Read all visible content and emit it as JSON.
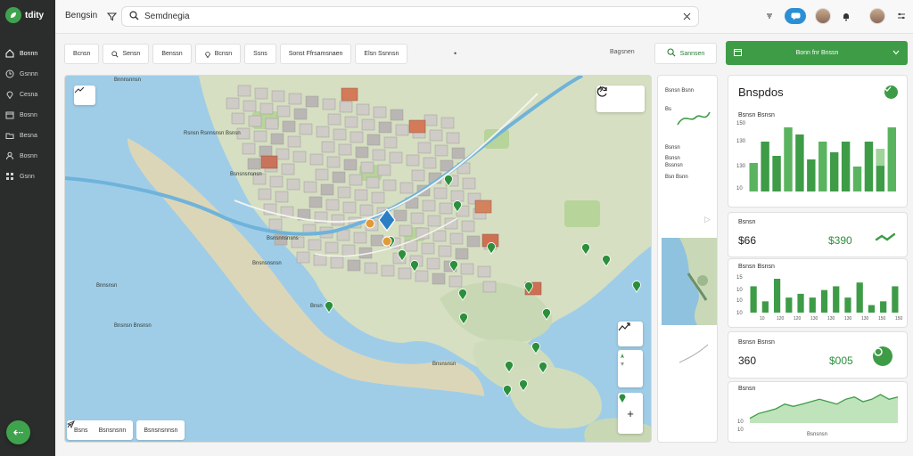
{
  "app": {
    "logo_text": "tdity",
    "brand": "Bengsin"
  },
  "rail": [
    {
      "label": "Bonnn",
      "icon": "home-icon"
    },
    {
      "label": "Gsnnn",
      "icon": "clock-icon"
    },
    {
      "label": "Cesna",
      "icon": "pin-icon"
    },
    {
      "label": "Bosnn",
      "icon": "calendar-icon"
    },
    {
      "label": "Besna",
      "icon": "folder-icon"
    },
    {
      "label": "Bosnn",
      "icon": "person-icon"
    },
    {
      "label": "Gsnn",
      "icon": "grid-icon"
    }
  ],
  "search": {
    "value": "Semdnegia"
  },
  "filters": [
    {
      "label": "Bcnsn",
      "icon": null
    },
    {
      "label": "Sensn",
      "icon": "search-icon"
    },
    {
      "label": "Benssn",
      "icon": null
    },
    {
      "label": "Bcnsn",
      "icon": "pin-icon"
    },
    {
      "label": "Ssns",
      "icon": null
    },
    {
      "label": "Sonst Ffrsamsnaen",
      "icon": null
    },
    {
      "label": "Elsn Ssnnsn",
      "icon": null
    }
  ],
  "filters_more": "•",
  "reset_label": "Bagsnen",
  "saved_label": "Sannsen",
  "primary_label": "Bonn fnr Bnssn",
  "map": {
    "labels": [
      {
        "text": "Bnnnsnnsn"
      },
      {
        "text": "Rsnsn Rsnnsnsn Bsnsn"
      },
      {
        "text": "Bsnsnsnsnsn"
      },
      {
        "text": "Bsnsnnsnsns"
      },
      {
        "text": "Bnsnsnsnsn"
      },
      {
        "text": "Bnsn"
      },
      {
        "text": "Bnsnsn Bnsnsn"
      },
      {
        "text": "Bnsnsnsn"
      },
      {
        "text": "Bnnsnsn"
      }
    ],
    "bottom_left": "Bsns",
    "bottom_mid": "Bsnsnsnn",
    "bottom_right": "Bsnsnsnnsn"
  },
  "mid_panel": {
    "rows": [
      "Bsnsn Bsnn",
      "Bs",
      "Bsnsn",
      "Bsnsn",
      "Bssnsn",
      "Bsn Bsnn"
    ]
  },
  "cards": {
    "overview": {
      "title": "Bnspdos",
      "caption": "Bsnsn Bsnsn",
      "ticks": [
        "150",
        "130",
        "130",
        "10"
      ],
      "values": [
        8,
        14,
        10,
        18,
        16,
        9,
        14,
        11,
        14,
        7,
        14,
        12,
        18
      ],
      "tick_levels": [
        150,
        130,
        130,
        10
      ]
    },
    "stat1": {
      "caption": "Bsnsn",
      "value": "$66",
      "delta": "$390"
    },
    "bars2": {
      "caption": "Bsnsn Bsnsn",
      "ticks": [
        "15",
        "10",
        "10",
        "10"
      ],
      "values": [
        7,
        3,
        9,
        4,
        5,
        4,
        6,
        7,
        4,
        8,
        2,
        3,
        7
      ],
      "x_labels": [
        "10",
        "120",
        "120",
        "130",
        "130",
        "130",
        "130",
        "150",
        "150"
      ]
    },
    "stat2": {
      "caption": "Bsnsn Bsnsn",
      "value": "360",
      "delta": "$005"
    },
    "area": {
      "caption": "Bsnsn",
      "ticks": [
        "10",
        "10"
      ],
      "footer": "Bsnsnsn",
      "values": [
        2,
        4,
        5,
        6,
        8,
        7,
        8,
        9,
        10,
        9,
        8,
        10,
        11,
        9,
        10,
        12,
        10,
        11
      ]
    }
  },
  "colors": {
    "accent": "#3e9c47",
    "blue": "#2c8fd6",
    "water": "#9fcde8",
    "land": "#d9dfc6",
    "rail": "#2b2d2c"
  }
}
